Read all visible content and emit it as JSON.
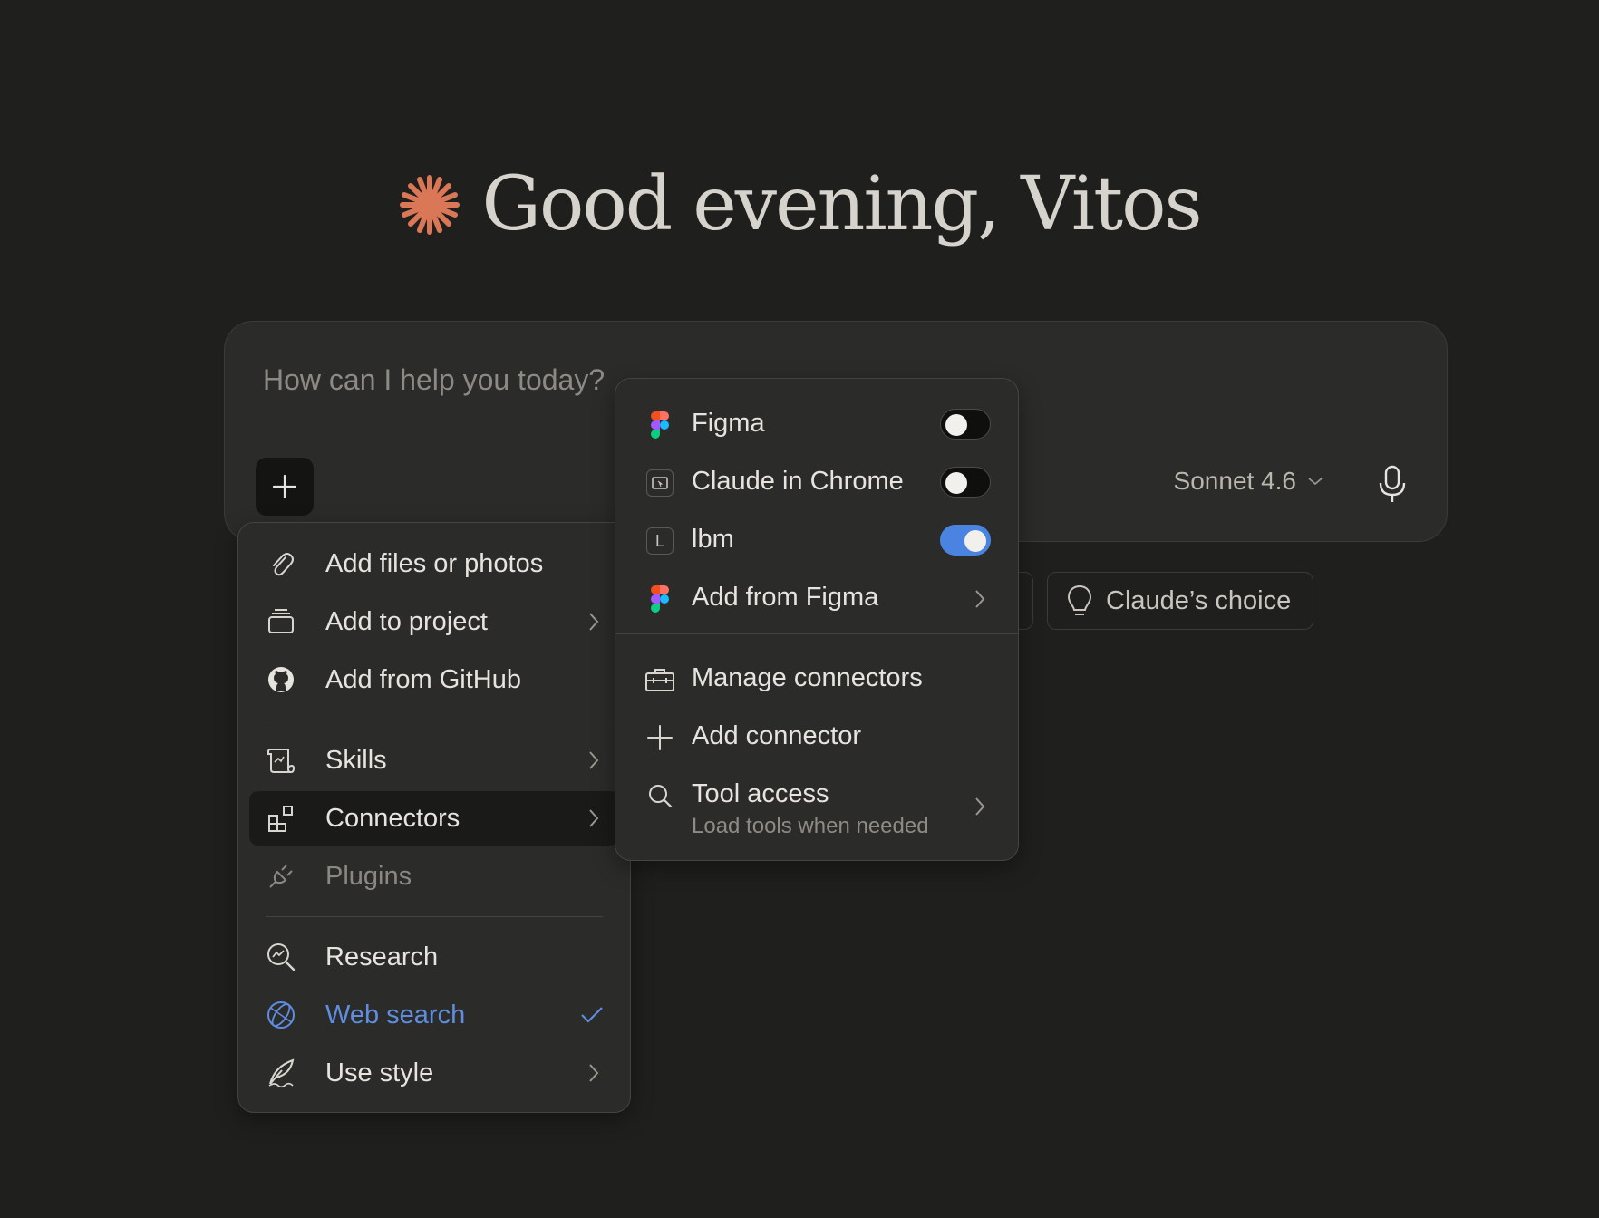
{
  "greeting": {
    "text": "Good evening, Vitos",
    "icon": "claude-burst-icon",
    "accent": "#d97757"
  },
  "composer": {
    "placeholder": "How can I help you today?",
    "model": "Sonnet 4.6"
  },
  "chips": {
    "claudes_choice": "Claude’s choice"
  },
  "menu": {
    "items": [
      {
        "label": "Add files or photos",
        "icon": "paperclip-icon"
      },
      {
        "label": "Add to project",
        "icon": "project-icon",
        "submenu": true
      },
      {
        "label": "Add from GitHub",
        "icon": "github-icon"
      },
      {
        "label": "Skills",
        "icon": "scroll-icon",
        "submenu": true
      },
      {
        "label": "Connectors",
        "icon": "connectors-icon",
        "submenu": true,
        "highlighted": true
      },
      {
        "label": "Plugins",
        "icon": "plug-icon",
        "disabled": true
      },
      {
        "label": "Research",
        "icon": "research-icon"
      },
      {
        "label": "Web search",
        "icon": "globe-icon",
        "checked": true,
        "color": "#5f8de0"
      },
      {
        "label": "Use style",
        "icon": "feather-icon",
        "submenu": true
      }
    ]
  },
  "connectors": {
    "items": [
      {
        "label": "Figma",
        "icon": "figma-icon",
        "enabled": false
      },
      {
        "label": "Claude in Chrome",
        "icon": "chrome-window-icon",
        "enabled": false
      },
      {
        "label": "lbm",
        "icon": "letter-l-icon",
        "icon_letter": "L",
        "enabled": true
      },
      {
        "label": "Add from Figma",
        "icon": "figma-icon",
        "submenu": true
      }
    ],
    "actions": [
      {
        "label": "Manage connectors",
        "icon": "toolbox-icon"
      },
      {
        "label": "Add connector",
        "icon": "plus-icon"
      },
      {
        "label": "Tool access",
        "sublabel": "Load tools when needed",
        "icon": "search-icon",
        "submenu": true
      }
    ],
    "toggle_on_color": "#4b84e0"
  }
}
